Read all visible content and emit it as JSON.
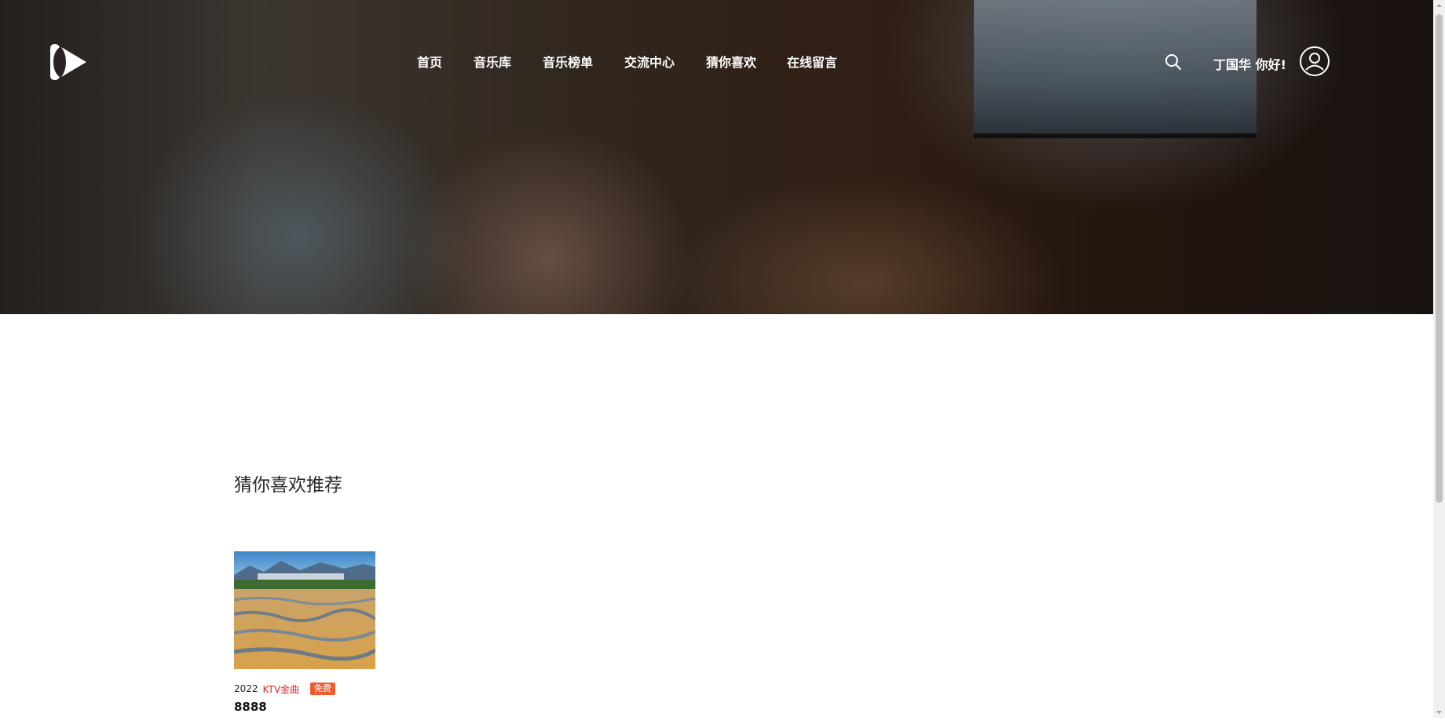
{
  "nav": {
    "items": [
      {
        "label": "首页"
      },
      {
        "label": "音乐库"
      },
      {
        "label": "音乐榜单"
      },
      {
        "label": "交流中心"
      },
      {
        "label": "猜你喜欢"
      },
      {
        "label": "在线留言"
      }
    ]
  },
  "header": {
    "greeting": "丁国华 你好!",
    "logo_icon": "play-logo-icon",
    "search_icon": "search-icon",
    "user_icon": "user-avatar-icon"
  },
  "recommend": {
    "title": "猜你喜欢推荐",
    "items": [
      {
        "year": "2022",
        "category": "KTV金曲",
        "badge": "免费",
        "title": "8888"
      }
    ]
  },
  "colors": {
    "accent_red": "#d8282a",
    "badge_orange": "#f25b2b",
    "nav_text": "#ffffff"
  }
}
